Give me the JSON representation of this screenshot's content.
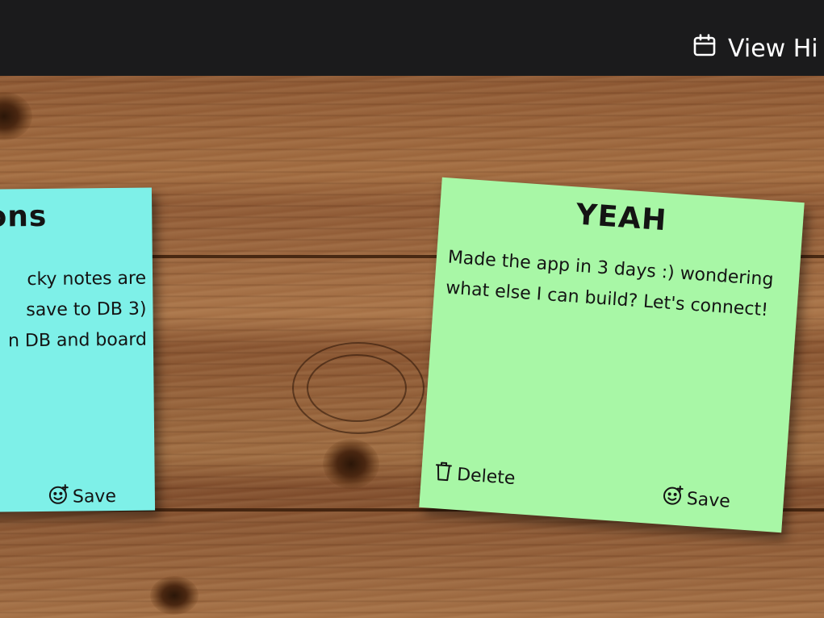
{
  "header": {
    "history_label": "View Hi",
    "history_icon": "calendar-icon"
  },
  "notes": [
    {
      "title": "ions",
      "body_lines": [
        "cky notes are",
        "save to DB  3)",
        "n DB and board"
      ],
      "save_label": "Save",
      "color": "#7ef0e8"
    },
    {
      "title": "YEAH",
      "body_lines": [
        "Made the app in 3 days :) wondering",
        "what else I can build? Let's connect!"
      ],
      "delete_label": "Delete",
      "save_label": "Save",
      "color": "#a8f7a6"
    }
  ],
  "colors": {
    "header_bg": "#1b1b1c",
    "header_text": "#ffffff"
  }
}
